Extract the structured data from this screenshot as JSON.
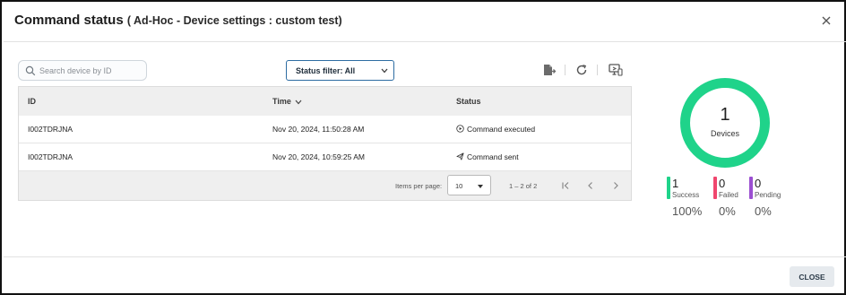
{
  "dialog": {
    "title": "Command status",
    "subtitle": "( Ad-Hoc - Device settings : custom test)",
    "close_button": "CLOSE"
  },
  "search": {
    "placeholder": "Search device by ID",
    "value": ""
  },
  "filter": {
    "label": "Status filter: All"
  },
  "toolbar": {
    "icons": [
      "export-icon",
      "refresh-icon",
      "remote-desktop-icon"
    ]
  },
  "table": {
    "columns": [
      "ID",
      "Time",
      "Status"
    ],
    "rows": [
      {
        "id": "I002TDRJNA",
        "time": "Nov 20, 2024, 11:50:28 AM",
        "status": "Command executed",
        "status_icon": "play-circle-icon"
      },
      {
        "id": "I002TDRJNA",
        "time": "Nov 20, 2024, 10:59:25 AM",
        "status": "Command sent",
        "status_icon": "send-icon"
      }
    ],
    "footer": {
      "items_per_page_label": "Items per page:",
      "items_per_page": "10",
      "range": "1 – 2 of 2"
    }
  },
  "summary": {
    "total": "1",
    "total_label": "Devices",
    "ring_color": "#1fd38a",
    "legend": [
      {
        "count": "1",
        "label": "Success",
        "percent": "100%",
        "color": "#1fd38a"
      },
      {
        "count": "0",
        "label": "Failed",
        "percent": "0%",
        "color": "#f0466e"
      },
      {
        "count": "0",
        "label": "Pending",
        "percent": "0%",
        "color": "#9b4fd1"
      }
    ]
  }
}
